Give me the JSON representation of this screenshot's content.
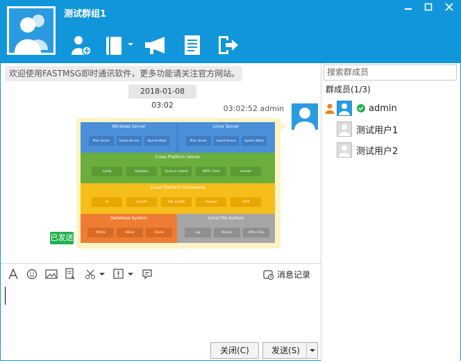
{
  "window": {
    "title": "测试群组1",
    "minimize_icon": "minimize-icon",
    "maximize_icon": "maximize-icon",
    "close_icon": "close-icon"
  },
  "toolbar": {
    "items": [
      "add-member-icon",
      "notebook-icon",
      "broadcast-icon",
      "document-icon",
      "exit-icon"
    ]
  },
  "chat": {
    "notice": "欢迎使用FASTMSG即时通讯软件，更多功能请关注官方网站。",
    "timestamp": "2018-01-08 03:02",
    "message_meta": "03:02:52 admin",
    "sent_status": "已发送",
    "image": {
      "windows_server": "Windows Server",
      "linux_server": "Linux Server",
      "ws_items": [
        "Main Server",
        "Guard Service",
        "Apache Httpd"
      ],
      "ls_items": [
        "Main Server",
        "Guard Service",
        "Apache Httpd"
      ],
      "cross_server": "Cross Platform Server",
      "cs_items": [
        "Config",
        "Database",
        "Cache & Context",
        "SMTP / Push",
        "Listener"
      ],
      "cross_framework": "Cross Platform Framework",
      "cf_items": [
        "IO",
        "Sock(AI)",
        "XML & JSON",
        "Protobuf",
        "XSTP"
      ],
      "database_system": "Database System",
      "db_items": [
        "MYSQL",
        "SQLite",
        "Oracle"
      ],
      "local_file_system": "Local File System",
      "fs_items": [
        "Log",
        "Pictures",
        "Offline Files"
      ]
    }
  },
  "editor": {
    "tools": [
      "font-icon",
      "emoji-icon",
      "image-icon",
      "file-icon",
      "scissors-icon",
      "alert-icon",
      "bubble-icon"
    ],
    "history_label": "消息记录",
    "close_label": "关闭(C)",
    "send_label": "发送(S)"
  },
  "members": {
    "search_placeholder": "搜索群成员",
    "count_label": "群成员(1/3)",
    "list": [
      {
        "name": "admin",
        "online": true,
        "owner": true
      },
      {
        "name": "测试用户1",
        "online": false,
        "owner": false
      },
      {
        "name": "测试用户2",
        "online": false,
        "owner": false
      }
    ]
  },
  "colors": {
    "primary": "#1296db",
    "sent_badge": "#22b14c",
    "bubble": "#fdf4c3"
  }
}
